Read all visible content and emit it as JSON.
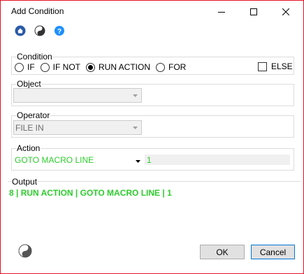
{
  "window": {
    "title": "Add Condition"
  },
  "toolbar": {
    "icons": [
      "home-icon",
      "yin-yang-icon",
      "help-icon"
    ]
  },
  "condition": {
    "label": "Condition",
    "options": [
      "IF",
      "IF NOT",
      "RUN ACTION",
      "FOR"
    ],
    "selected": "RUN ACTION",
    "else_label": "ELSE",
    "else_checked": false
  },
  "object": {
    "label": "Object",
    "value": ""
  },
  "operator": {
    "label": "Operator",
    "value": "FILE IN"
  },
  "action": {
    "label": "Action",
    "value": "GOTO MACRO LINE",
    "line_number": "1",
    "color": "#2ecc2e"
  },
  "output": {
    "label": "Output",
    "text": "8 | RUN ACTION | GOTO MACRO LINE | 1"
  },
  "buttons": {
    "ok": "OK",
    "cancel": "Cancel"
  },
  "colors": {
    "accent_border": "#e81123",
    "output_green": "#2ecc2e",
    "help_blue": "#1e90ff"
  }
}
